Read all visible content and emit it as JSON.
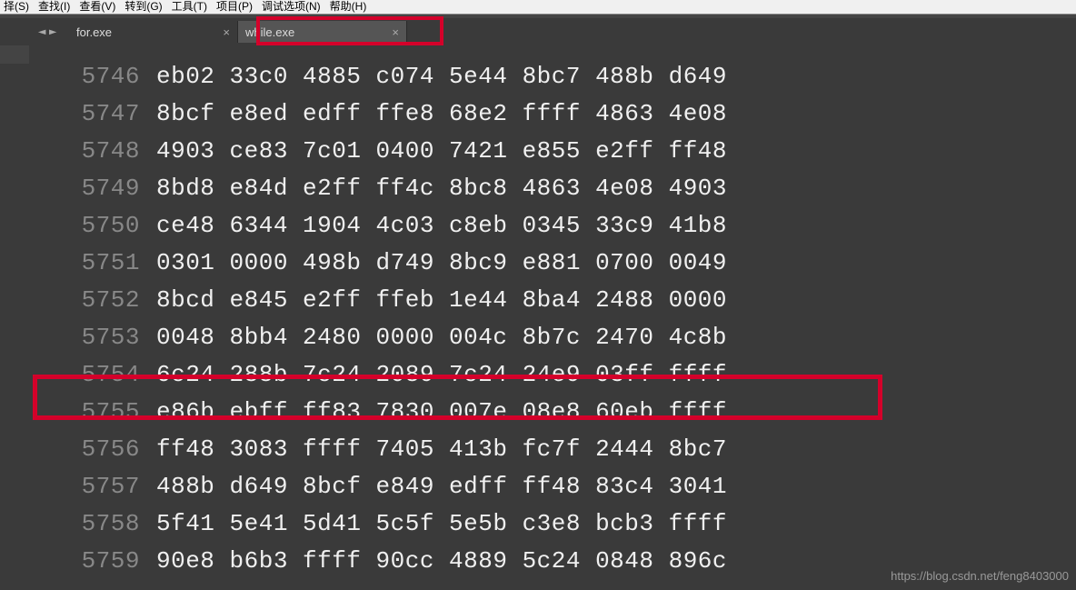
{
  "menu": {
    "items": [
      "择(S)",
      "查找(I)",
      "查看(V)",
      "转到(G)",
      "工具(T)",
      "项目(P)",
      "调试选项(N)",
      "帮助(H)"
    ]
  },
  "nav": {
    "prev": "◄",
    "next": "►"
  },
  "tabs": [
    {
      "label": "for.exe",
      "active": false,
      "close": "×"
    },
    {
      "label": "while.exe",
      "active": true,
      "close": "×"
    }
  ],
  "hex": {
    "rows": [
      {
        "num": "5746",
        "bytes": "eb02 33c0 4885 c074 5e44 8bc7 488b d649"
      },
      {
        "num": "5747",
        "bytes": "8bcf e8ed edff ffe8 68e2 ffff 4863 4e08"
      },
      {
        "num": "5748",
        "bytes": "4903 ce83 7c01 0400 7421 e855 e2ff ff48"
      },
      {
        "num": "5749",
        "bytes": "8bd8 e84d e2ff ff4c 8bc8 4863 4e08 4903"
      },
      {
        "num": "5750",
        "bytes": "ce48 6344 1904 4c03 c8eb 0345 33c9 41b8"
      },
      {
        "num": "5751",
        "bytes": "0301 0000 498b d749 8bc9 e881 0700 0049"
      },
      {
        "num": "5752",
        "bytes": "8bcd e845 e2ff ffeb 1e44 8ba4 2488 0000"
      },
      {
        "num": "5753",
        "bytes": "0048 8bb4 2480 0000 004c 8b7c 2470 4c8b"
      },
      {
        "num": "5754",
        "bytes": "6c24 288b 7c24 2089 7c24 24e9 03ff ffff"
      },
      {
        "num": "5755",
        "bytes": "e86b ebff ff83 7830 007e 08e8 60eb ffff"
      },
      {
        "num": "5756",
        "bytes": "ff48 3083 ffff 7405 413b fc7f 2444 8bc7"
      },
      {
        "num": "5757",
        "bytes": "488b d649 8bcf e849 edff ff48 83c4 3041"
      },
      {
        "num": "5758",
        "bytes": "5f41 5e41 5d41 5c5f 5e5b c3e8 bcb3 ffff"
      },
      {
        "num": "5759",
        "bytes": "90e8 b6b3 ffff 90cc 4889 5c24 0848 896c"
      }
    ]
  },
  "watermark": "https://blog.csdn.net/feng8403000"
}
